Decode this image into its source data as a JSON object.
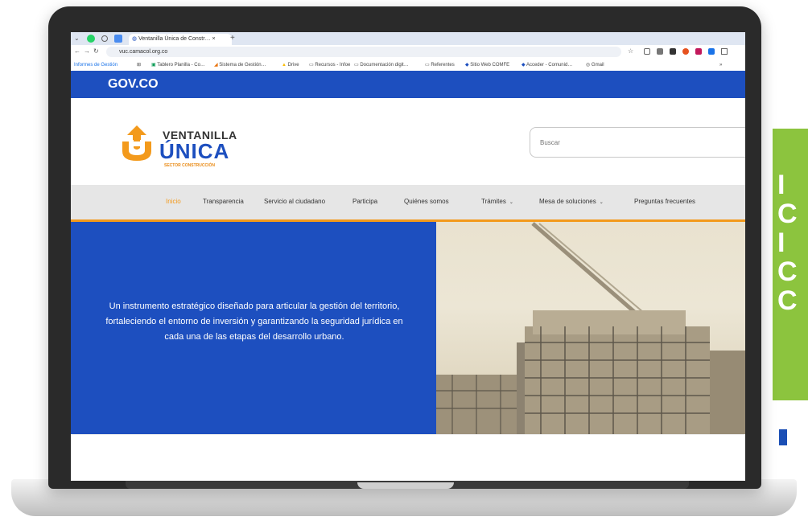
{
  "side_panel": {
    "glyphs": [
      "I",
      "C",
      "I",
      "C",
      "C"
    ]
  },
  "browser": {
    "tabs": [
      {
        "label": "Ventanilla Única de Constr…"
      }
    ],
    "new_tab": "+",
    "url": "vuc.camacol.org.co",
    "bookmarks": [
      "Informes de Gestión",
      "Tablero Planilla - Co…",
      "Sistema de Gestión…",
      "Drive",
      "Recursos - Infoe",
      "Documentación digit…",
      "Referentes",
      "Sitio Web COMFE",
      "Acceder - Comunid…",
      "Gmail"
    ]
  },
  "site": {
    "gov_logo": "GOV.CO",
    "logo": {
      "line1": "VENTANILLA",
      "line2": "ÚNICA",
      "sub": "SECTOR CONSTRUCCIÓN"
    },
    "search_placeholder": "Buscar",
    "nav": [
      {
        "label": "Inicio",
        "active": true
      },
      {
        "label": "Transparencia"
      },
      {
        "label": "Servicio al ciudadano"
      },
      {
        "label": "Participa"
      },
      {
        "label": "Quiénes somos"
      },
      {
        "label": "Trámites",
        "dropdown": true
      },
      {
        "label": "Mesa de soluciones",
        "dropdown": true
      },
      {
        "label": "Preguntas frecuentes"
      }
    ],
    "hero_text": "Un instrumento estratégico diseñado para articular la gestión del territorio, fortaleciendo el entorno de inversión y garantizando la seguridad jurídica en cada una de las etapas del desarrollo urbano."
  },
  "colors": {
    "gov_blue": "#1d4fbf",
    "accent_orange": "#f39a1c",
    "panel_green": "#8cc43e"
  }
}
